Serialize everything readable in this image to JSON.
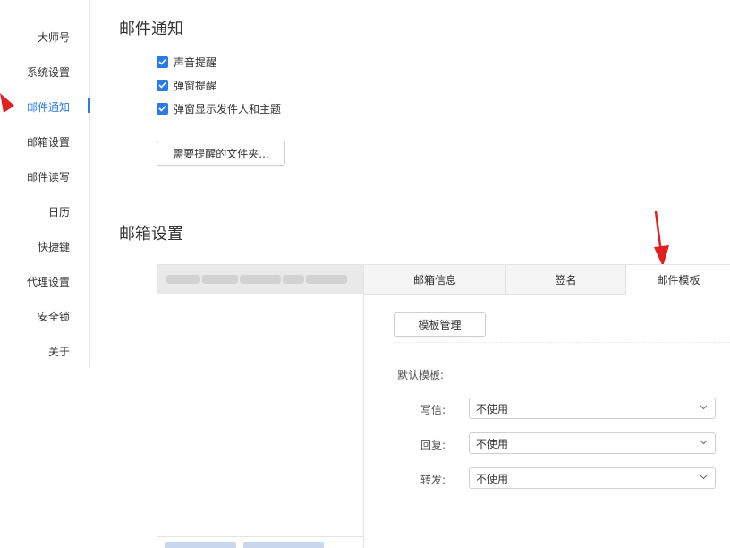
{
  "sidebar": {
    "items": [
      {
        "label": "大师号"
      },
      {
        "label": "系统设置"
      },
      {
        "label": "邮件通知"
      },
      {
        "label": "邮箱设置"
      },
      {
        "label": "邮件读写"
      },
      {
        "label": "日历"
      },
      {
        "label": "快捷键"
      },
      {
        "label": "代理设置"
      },
      {
        "label": "安全锁"
      },
      {
        "label": "关于"
      }
    ],
    "active_index": 2
  },
  "notification": {
    "title": "邮件通知",
    "options": [
      {
        "label": "声音提醒",
        "checked": true
      },
      {
        "label": "弹窗提醒",
        "checked": true
      },
      {
        "label": "弹窗显示发件人和主题",
        "checked": true
      }
    ],
    "folders_button": "需要提醒的文件夹..."
  },
  "mailbox": {
    "title": "邮箱设置",
    "tabs": [
      {
        "label": "邮箱信息"
      },
      {
        "label": "签名"
      },
      {
        "label": "邮件模板"
      }
    ],
    "active_tab": 2,
    "template_manage_button": "模板管理",
    "default_template_label": "默认模板:",
    "fields": [
      {
        "label": "写信:",
        "value": "不使用"
      },
      {
        "label": "回复:",
        "value": "不使用"
      },
      {
        "label": "转发:",
        "value": "不使用"
      }
    ]
  },
  "colors": {
    "accent": "#2b7be5",
    "annotation_arrow": "#e02020"
  },
  "icons": {
    "checkbox": "check-icon",
    "select": "chevron-down-icon",
    "annotation": "red-arrow-icon"
  }
}
